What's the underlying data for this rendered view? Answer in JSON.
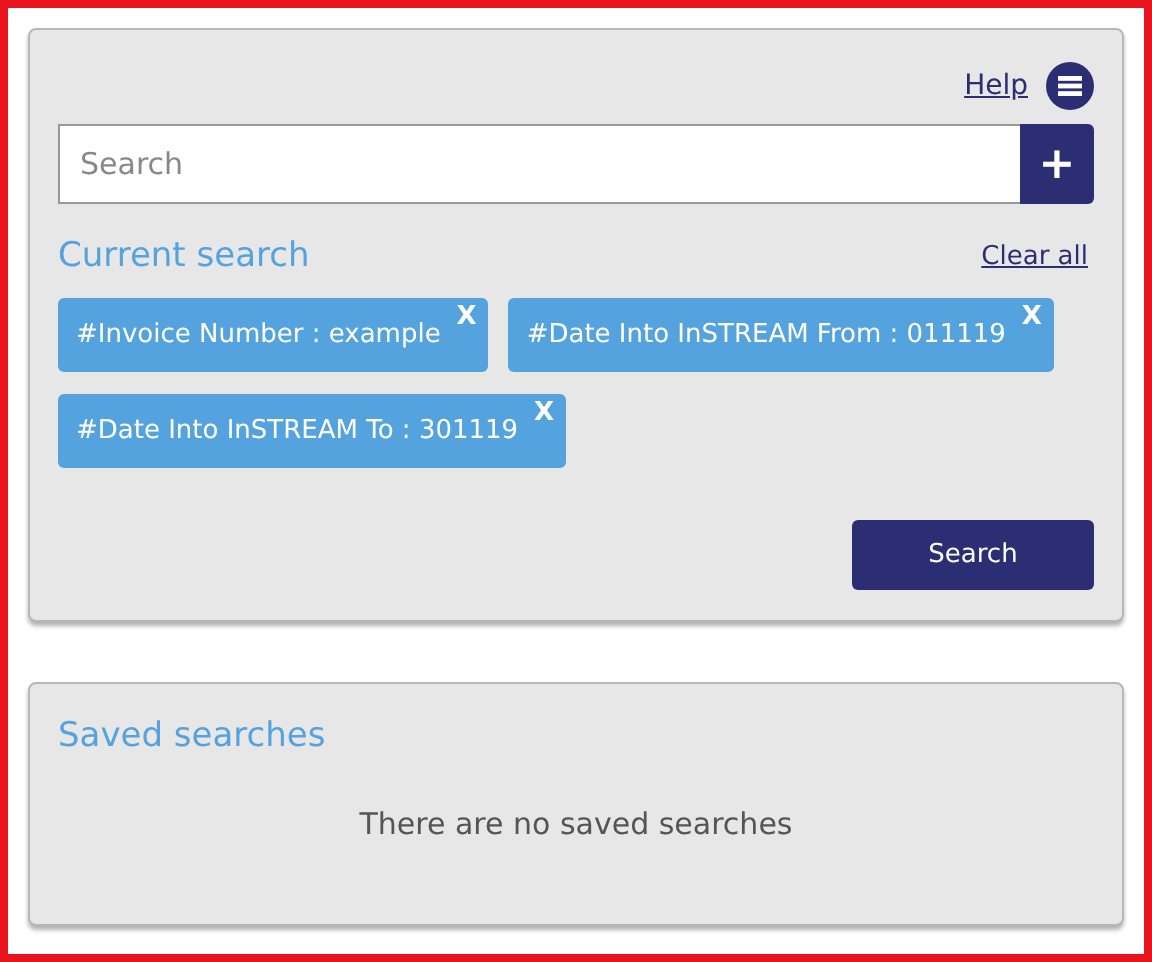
{
  "help_link": "Help",
  "search": {
    "placeholder": "Search",
    "add_button": "+"
  },
  "current_search": {
    "title": "Current search",
    "clear_all": "Clear all",
    "filters": [
      {
        "label": "#Invoice Number : example",
        "remove": "X"
      },
      {
        "label": "#Date Into InSTREAM From : 011119",
        "remove": "X"
      },
      {
        "label": "#Date Into InSTREAM To : 301119",
        "remove": "X"
      }
    ],
    "search_button": "Search"
  },
  "saved_searches": {
    "title": "Saved searches",
    "empty_message": "There are no saved searches"
  }
}
